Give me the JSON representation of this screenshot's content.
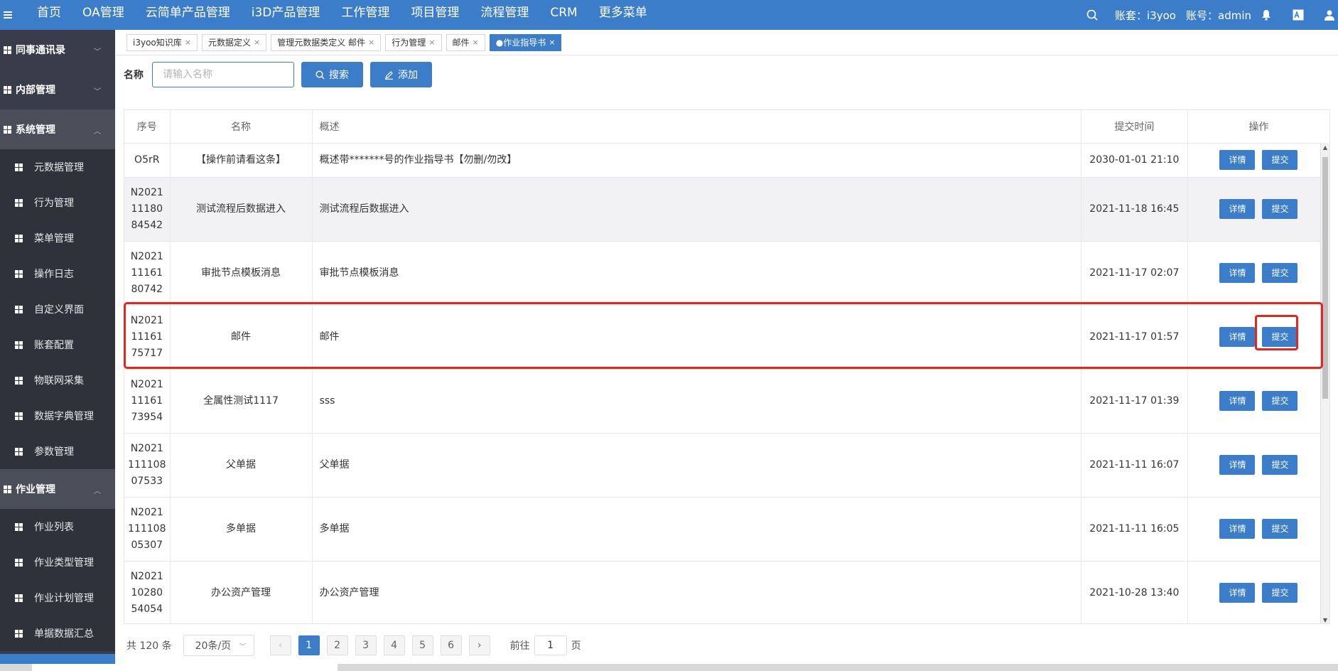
{
  "topnav": {
    "items": [
      "首页",
      "OA管理",
      "云简单产品管理",
      "i3D产品管理",
      "工作管理",
      "项目管理",
      "流程管理",
      "CRM",
      "更多菜单"
    ],
    "account_set": "账套：i3yoo",
    "account": "账号：admin"
  },
  "sidebar": {
    "groups": {
      "contacts": "同事通讯录",
      "internal": "内部管理",
      "system": "系统管理",
      "job": "作业管理"
    },
    "system_items": [
      "元数据管理",
      "行为管理",
      "菜单管理",
      "操作日志",
      "自定义界面",
      "账套配置",
      "物联网采集",
      "数据字典管理",
      "参数管理"
    ],
    "job_items": [
      "作业列表",
      "作业类型管理",
      "作业计划管理",
      "单据数据汇总"
    ]
  },
  "tabs": [
    {
      "label": "i3yoo知识库"
    },
    {
      "label": "元数据定义"
    },
    {
      "label": "管理元数据类定义 邮件"
    },
    {
      "label": "行为管理"
    },
    {
      "label": "邮件"
    },
    {
      "label": "●作业指导书"
    }
  ],
  "search": {
    "label": "名称",
    "placeholder": "请输入名称",
    "search_button": "搜索",
    "add_button": "添加"
  },
  "table": {
    "headers": [
      "序号",
      "名称",
      "概述",
      "提交时间",
      "操作"
    ],
    "detail_label": "详情",
    "submit_label": "提交",
    "rows": [
      {
        "id": "O5rR",
        "name": "【操作前请看这条】",
        "desc": "概述带*******号的作业指导书【勿删/勿改】",
        "time": "2030-01-01 21:10"
      },
      {
        "id1": "N2021",
        "id2": "11180",
        "id3": "84542",
        "name": "测试流程后数据进入",
        "desc": "测试流程后数据进入",
        "time": "2021-11-18 16:45"
      },
      {
        "id1": "N2021",
        "id2": "11161",
        "id3": "80742",
        "name": "审批节点模板消息",
        "desc": "审批节点模板消息",
        "time": "2021-11-17 02:07"
      },
      {
        "id1": "N2021",
        "id2": "11161",
        "id3": "75717",
        "name": "邮件",
        "desc": "邮件",
        "time": "2021-11-17 01:57"
      },
      {
        "id1": "N2021",
        "id2": "11161",
        "id3": "73954",
        "name": "全属性测试1117",
        "desc": "sss",
        "time": "2021-11-17 01:39"
      },
      {
        "id1": "N2021",
        "id2": "111108",
        "id3": "07533",
        "name": "父单据",
        "desc": "父单据",
        "time": "2021-11-11 16:07"
      },
      {
        "id1": "N2021",
        "id2": "111108",
        "id3": "05307",
        "name": "多单据",
        "desc": "多单据",
        "time": "2021-11-11 16:05"
      },
      {
        "id1": "N2021",
        "id2": "10280",
        "id3": "54054",
        "name": "办公资产管理",
        "desc": "办公资产管理",
        "time": "2021-10-28 13:40"
      }
    ]
  },
  "pager": {
    "total": "共 120 条",
    "page_size": "20条/页",
    "pages": [
      "1",
      "2",
      "3",
      "4",
      "5",
      "6"
    ],
    "goto_label": "前往",
    "goto_value": "1",
    "page_suffix": "页"
  },
  "colors": {
    "primary": "#3b7dc8",
    "sidebar": "#393d49",
    "highlight": "#e8251d"
  }
}
